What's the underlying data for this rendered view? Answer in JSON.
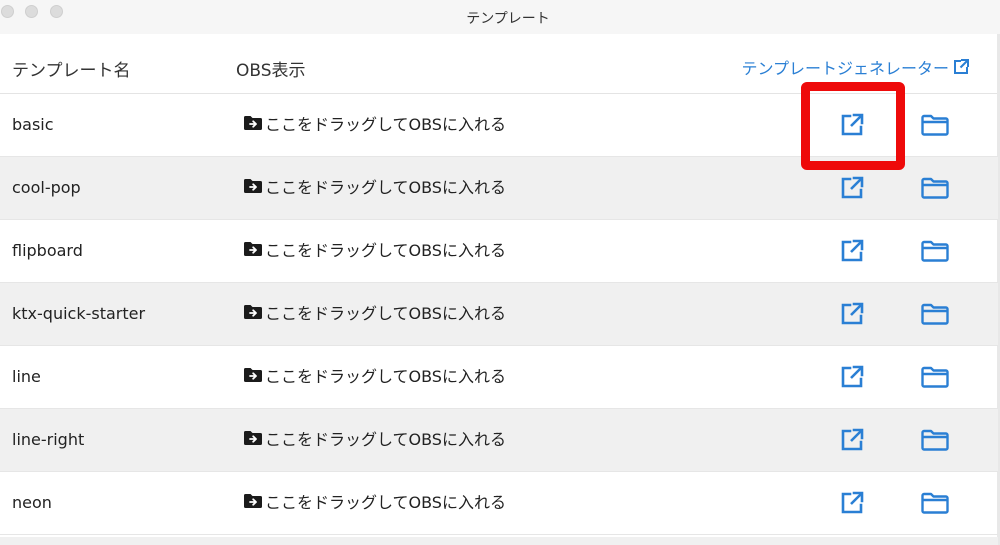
{
  "window": {
    "title": "テンプレート"
  },
  "header": {
    "col_name": "テンプレート名",
    "col_obs": "OBS表示",
    "generator_link": "テンプレートジェネレーター",
    "generator_icon": "external-link-icon"
  },
  "drag_label": "ここをドラッグしてOBSに入れる",
  "icons": {
    "drag": "folder-arrow-icon",
    "open": "external-link-icon",
    "folder": "folder-icon"
  },
  "colors": {
    "accent": "#2a7fd4",
    "highlight": "#ee0a0a",
    "row_alt": "#f0f0f0"
  },
  "rows": [
    {
      "name": "basic",
      "drag_label": "ここをドラッグしてOBSに入れる"
    },
    {
      "name": "cool-pop",
      "drag_label": "ここをドラッグしてOBSに入れる"
    },
    {
      "name": "flipboard",
      "drag_label": "ここをドラッグしてOBSに入れる"
    },
    {
      "name": "ktx-quick-starter",
      "drag_label": "ここをドラッグしてOBSに入れる"
    },
    {
      "name": "line",
      "drag_label": "ここをドラッグしてOBSに入れる"
    },
    {
      "name": "line-right",
      "drag_label": "ここをドラッグしてOBSに入れる"
    },
    {
      "name": "neon",
      "drag_label": "ここをドラッグしてOBSに入れる"
    }
  ]
}
